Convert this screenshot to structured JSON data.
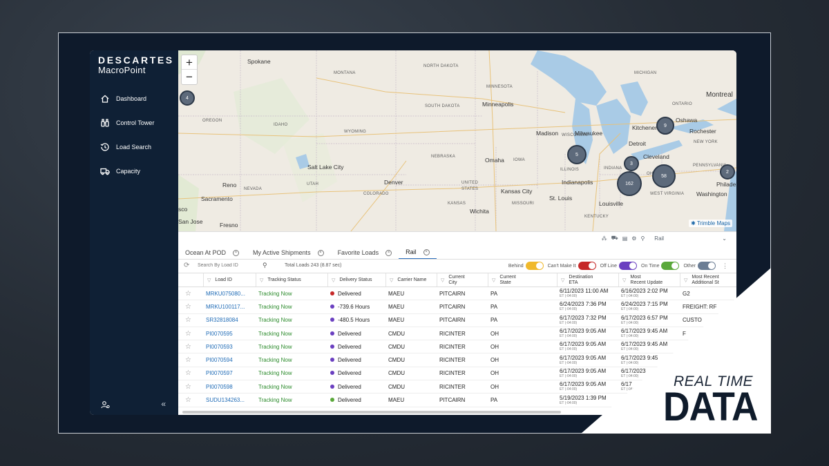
{
  "brand": {
    "logo_top": "DESCARTES",
    "logo_bottom": "MacroPoint"
  },
  "sidebar": {
    "items": [
      {
        "label": "Dashboard",
        "icon": "home-icon"
      },
      {
        "label": "Control Tower",
        "icon": "binoculars-icon"
      },
      {
        "label": "Load Search",
        "icon": "history-icon"
      },
      {
        "label": "Capacity",
        "icon": "truck-icon"
      }
    ],
    "collapse_glyph": "«"
  },
  "map": {
    "states": [
      "NORTH DAKOTA",
      "SOUTH DAKOTA",
      "MINNESOTA",
      "WISCONSIN",
      "MICHIGAN",
      "IOWA",
      "NEBRASKA",
      "KANSAS",
      "MISSOURI",
      "ILLINOIS",
      "INDIANA",
      "OHIO",
      "KENTUCKY",
      "WEST VIRGINIA",
      "PENNSYLVANIA",
      "NEW YORK",
      "IDAHO",
      "OREGON",
      "WYOMING",
      "NEVADA",
      "UTAH",
      "COLORADO",
      "UNITED STATES",
      "ONTARIO",
      "MONTANA"
    ],
    "cities": [
      "Spokane",
      "Minneapolis",
      "Madison",
      "Milwaukee",
      "Detroit",
      "Cleveland",
      "Kitchener",
      "Oshawa",
      "Montreal",
      "Rochester",
      "Philadel",
      "Washington",
      "Louisville",
      "Indianapolis",
      "St. Louis",
      "Kansas City",
      "Omaha",
      "Wichita",
      "Denver",
      "Salt Lake City",
      "Reno",
      "Sacramento",
      "Fresno",
      "San Jose",
      "sco"
    ],
    "clusters": [
      "4",
      "9",
      "5",
      "3",
      "162",
      "58",
      "2"
    ],
    "zoom_in": "+",
    "zoom_out": "−",
    "attribution": "Trimble Maps"
  },
  "tabs": [
    {
      "label": "Ocean At POD",
      "active": false
    },
    {
      "label": "My Active Shipments",
      "active": false
    },
    {
      "label": "Favorite Loads",
      "active": false
    },
    {
      "label": "Rail",
      "active": true
    }
  ],
  "view_select": "Rail",
  "toolbar": {
    "search_placeholder": "Search By Load ID",
    "totals": "Total Loads 243 (8.87 sec)",
    "toggles": [
      {
        "label": "Behind",
        "color": "#f0b92c"
      },
      {
        "label": "Can't Make It",
        "color": "#c62828"
      },
      {
        "label": "Off Line",
        "color": "#6a3fc0"
      },
      {
        "label": "On Time",
        "color": "#5aa83a"
      },
      {
        "label": "Other",
        "color": "#6b7d94"
      }
    ]
  },
  "grid": {
    "headers": [
      "Load ID",
      "Tracking Status",
      "Delivery Status",
      "Carrier Name",
      "Current City",
      "Current State",
      "Destination ETA",
      "Most Recent Update",
      "Most Recent Additional St"
    ],
    "header_lines": [
      [
        "Load ID"
      ],
      [
        "Tracking Status"
      ],
      [
        "Delivery Status"
      ],
      [
        "Carrier Name"
      ],
      [
        "Current",
        "City"
      ],
      [
        "Current",
        "State"
      ],
      [
        "Destination",
        "ETA"
      ],
      [
        "Most",
        "Recent Update"
      ],
      [
        "Most Recent",
        "Additional St"
      ]
    ],
    "rows": [
      {
        "load_id": "MRKU075080...",
        "tracking": "Tracking Now",
        "delivery": "Delivered",
        "dot": "#c62828",
        "carrier": "MAEU",
        "city": "PITCAIRN",
        "state": "PA",
        "eta": "6/11/2023  11:00 AM",
        "eta_tz": "ET (-04:00)",
        "update": "6/16/2023  2:02 PM",
        "update_tz": "ET (-04:00)",
        "extra": "G2"
      },
      {
        "load_id": "MRKU100117...",
        "tracking": "Tracking Now",
        "delivery": "-739.6 Hours",
        "dot": "#6a3fc0",
        "carrier": "MAEU",
        "city": "PITCAIRN",
        "state": "PA",
        "eta": "6/24/2023  7:36 PM",
        "eta_tz": "ET (-04:00)",
        "update": "6/24/2023  7:15 PM",
        "update_tz": "ET (-04:00)",
        "extra": "FREIGHT: RF"
      },
      {
        "load_id": "SR32818084",
        "tracking": "Tracking Now",
        "delivery": "-480.5 Hours",
        "dot": "#6a3fc0",
        "carrier": "MAEU",
        "city": "PITCAIRN",
        "state": "PA",
        "eta": "6/17/2023  7:32 PM",
        "eta_tz": "ET (-04:00)",
        "update": "6/17/2023  6:57 PM",
        "update_tz": "ET (-04:00)",
        "extra": "CUSTO"
      },
      {
        "load_id": "PI0070595",
        "tracking": "Tracking Now",
        "delivery": "Delivered",
        "dot": "#6a3fc0",
        "carrier": "CMDU",
        "city": "RICINTER",
        "state": "OH",
        "eta": "6/17/2023  9:05 AM",
        "eta_tz": "ET (-04:00)",
        "update": "6/17/2023  9:45 AM",
        "update_tz": "ET (-04:00)",
        "extra": "F"
      },
      {
        "load_id": "PI0070593",
        "tracking": "Tracking Now",
        "delivery": "Delivered",
        "dot": "#6a3fc0",
        "carrier": "CMDU",
        "city": "RICINTER",
        "state": "OH",
        "eta": "6/17/2023  9:05 AM",
        "eta_tz": "ET (-04:00)",
        "update": "6/17/2023  9:45 AM",
        "update_tz": "ET (-04:00)",
        "extra": ""
      },
      {
        "load_id": "PI0070594",
        "tracking": "Tracking Now",
        "delivery": "Delivered",
        "dot": "#6a3fc0",
        "carrier": "CMDU",
        "city": "RICINTER",
        "state": "OH",
        "eta": "6/17/2023  9:05 AM",
        "eta_tz": "ET (-04:00)",
        "update": "6/17/2023  9:45",
        "update_tz": "ET (-04:00)",
        "extra": ""
      },
      {
        "load_id": "PI0070597",
        "tracking": "Tracking Now",
        "delivery": "Delivered",
        "dot": "#6a3fc0",
        "carrier": "CMDU",
        "city": "RICINTER",
        "state": "OH",
        "eta": "6/17/2023  9:05 AM",
        "eta_tz": "ET (-04:00)",
        "update": "6/17/2023",
        "update_tz": "ET (-04:00)",
        "extra": ""
      },
      {
        "load_id": "PI0070598",
        "tracking": "Tracking Now",
        "delivery": "Delivered",
        "dot": "#6a3fc0",
        "carrier": "CMDU",
        "city": "RICINTER",
        "state": "OH",
        "eta": "6/17/2023  9:05 AM",
        "eta_tz": "ET (-04:00)",
        "update": "6/17",
        "update_tz": "ET (-04:00)",
        "extra": ""
      },
      {
        "load_id": "SUDU134263...",
        "tracking": "Tracking Now",
        "delivery": "Delivered",
        "dot": "#5aa83a",
        "carrier": "MAEU",
        "city": "PITCAIRN",
        "state": "PA",
        "eta": "5/19/2023  1:39 PM",
        "eta_tz": "ET (-04:00)",
        "update": "",
        "update_tz": "",
        "extra": ""
      }
    ]
  },
  "promo": {
    "line1": "REAL TIME",
    "line2": "DATA"
  },
  "colors": {
    "sidebar": "#0f2035",
    "link": "#1f6bb6",
    "tracking": "#2a8a2a",
    "water": "#a9cbe6"
  }
}
